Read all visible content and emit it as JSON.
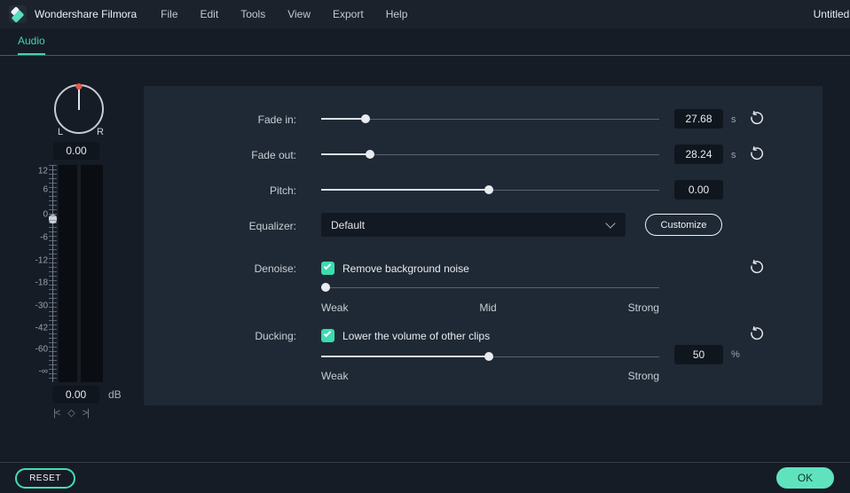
{
  "titlebar": {
    "app_title": "Wondershare Filmora",
    "menus": [
      "File",
      "Edit",
      "Tools",
      "View",
      "Export",
      "Help"
    ],
    "document_title": "Untitled :"
  },
  "tabbar": {
    "active_tab": "Audio"
  },
  "mixer": {
    "knob": {
      "left_label": "L",
      "right_label": "R",
      "value": "0.00"
    },
    "meter": {
      "scale": [
        "12",
        "6",
        "0",
        "-6",
        "-12",
        "-18",
        "-30",
        "-42",
        "-60",
        "-∞"
      ],
      "value": "0.00",
      "unit": "dB"
    },
    "keyframe_controls": {
      "prev": "|<",
      "add": "◇",
      "next": ">|"
    }
  },
  "panel": {
    "fade_in": {
      "label": "Fade in:",
      "value": "27.68",
      "unit": "s",
      "percent": 13
    },
    "fade_out": {
      "label": "Fade out:",
      "value": "28.24",
      "unit": "s",
      "percent": 14
    },
    "pitch": {
      "label": "Pitch:",
      "value": "0.00",
      "percent": 50
    },
    "equalizer": {
      "label": "Equalizer:",
      "selected": "Default",
      "button": "Customize"
    },
    "denoise": {
      "label": "Denoise:",
      "checkbox_label": "Remove background noise",
      "checked": true,
      "percent": 1,
      "scale_labels": [
        "Weak",
        "Mid",
        "Strong"
      ]
    },
    "ducking": {
      "label": "Ducking:",
      "checkbox_label": "Lower the volume of other clips",
      "checked": true,
      "percent": 50,
      "value": "50",
      "unit": "%",
      "scale_labels": [
        "Weak",
        "Strong"
      ]
    }
  },
  "footer": {
    "reset": "RESET",
    "ok": "OK"
  },
  "colors": {
    "accent_mint": "#5fe3be",
    "tab_active": "#41d5ab",
    "checkbox": "#3bdcae",
    "knob_dot_red": "#e8594b",
    "panel_bg": "#1f2935",
    "window_bg": "#161c26",
    "input_bg": "#10161e"
  }
}
